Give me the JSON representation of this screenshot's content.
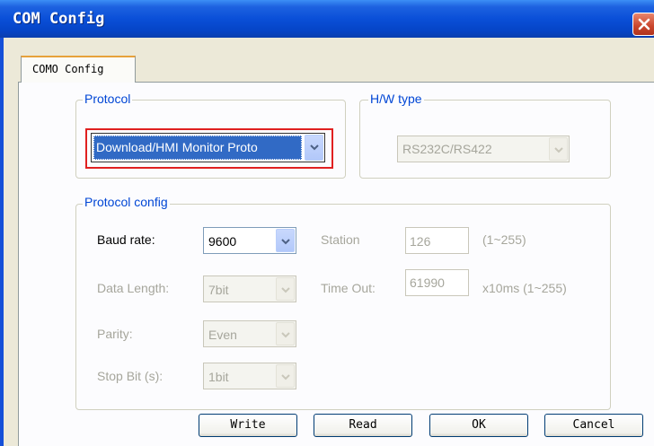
{
  "window": {
    "title": "COM Config"
  },
  "tab": {
    "label": "COMO Config"
  },
  "protocol": {
    "legend": "Protocol",
    "selected": "Download/HMI Monitor Proto"
  },
  "hw_type": {
    "legend": "H/W type",
    "selected": "RS232C/RS422"
  },
  "protocol_config": {
    "legend": "Protocol config",
    "baud_rate": {
      "label": "Baud rate:",
      "value": "9600"
    },
    "data_length": {
      "label": "Data Length:",
      "value": "7bit"
    },
    "parity": {
      "label": "Parity:",
      "value": "Even"
    },
    "stop_bit": {
      "label": "Stop Bit (s):",
      "value": "1bit"
    },
    "station": {
      "label": "Station",
      "value": "126",
      "range": "(1~255)"
    },
    "time_out": {
      "label": "Time Out:",
      "value": "61990",
      "range": "x10ms (1~255)"
    }
  },
  "buttons": {
    "write": "Write",
    "read": "Read",
    "ok": "OK",
    "cancel": "Cancel"
  },
  "colors": {
    "titlebar": "#0a4fd8",
    "legend_text": "#0046d5",
    "highlight_box": "#e02020",
    "close_button": "#c9452c"
  }
}
